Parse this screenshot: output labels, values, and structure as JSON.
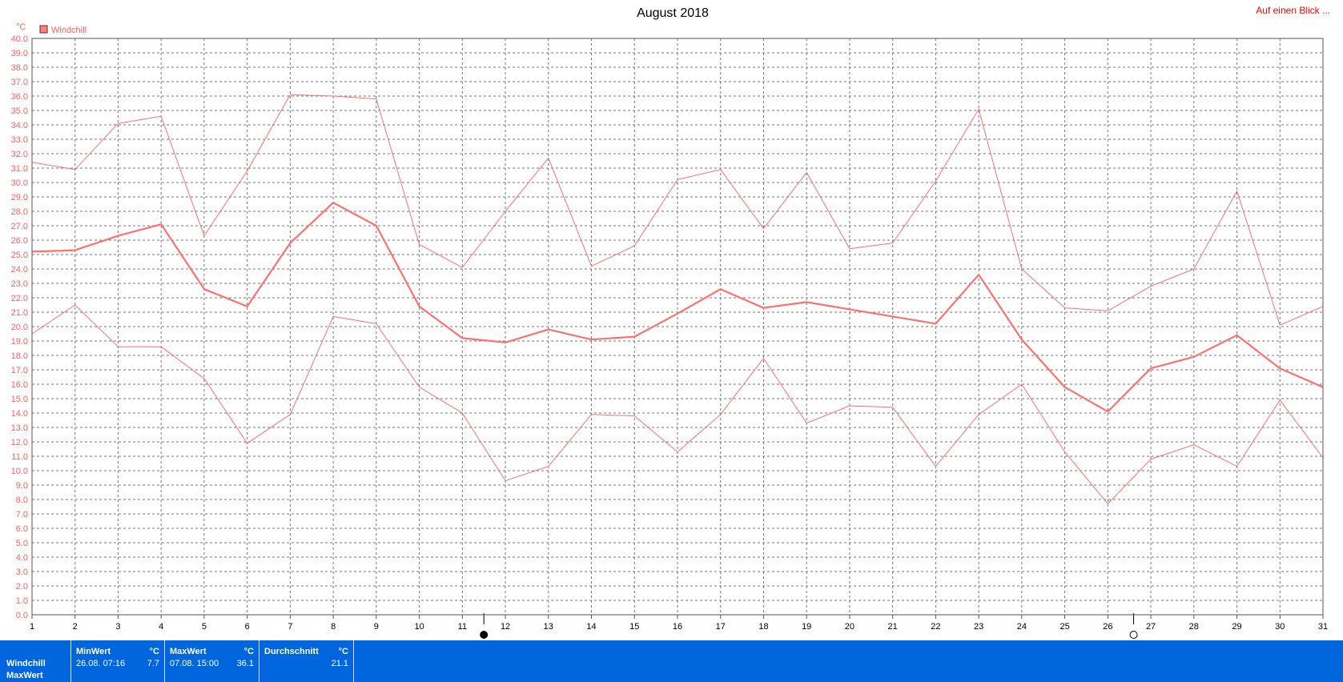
{
  "header": {
    "title": "August 2018",
    "link_label": "Auf einen Blick ..."
  },
  "colors": {
    "series": "#ff7070",
    "axis_text": "#ff6060",
    "stats_bg": "#0066dd"
  },
  "chart_data": {
    "type": "line",
    "title": "August 2018",
    "ylabel": "°C",
    "xlabel": "",
    "ylim": [
      0,
      40
    ],
    "ytick_step": 1,
    "grid": true,
    "legend": {
      "placement": "top-left",
      "entries": [
        "Windchill"
      ]
    },
    "x": [
      1,
      2,
      3,
      4,
      5,
      6,
      7,
      8,
      9,
      10,
      11,
      12,
      13,
      14,
      15,
      16,
      17,
      18,
      19,
      20,
      21,
      22,
      23,
      24,
      25,
      26,
      27,
      28,
      29,
      30,
      31
    ],
    "x_tick_labels": [
      "1",
      "2",
      "3",
      "4",
      "5",
      "6",
      "7",
      "8",
      "9",
      "10",
      "11",
      "12",
      "13",
      "14",
      "15",
      "16",
      "17",
      "18",
      "19",
      "20",
      "21",
      "22",
      "23",
      "24",
      "25",
      "26",
      "27",
      "28",
      "29",
      "30",
      "31"
    ],
    "series": [
      {
        "name": "Windchill",
        "role": "average",
        "values": [
          25.2,
          25.3,
          26.3,
          27.1,
          22.6,
          21.4,
          25.8,
          28.6,
          27.0,
          21.4,
          19.2,
          18.9,
          19.8,
          19.1,
          19.3,
          20.9,
          22.6,
          21.3,
          21.7,
          21.2,
          20.7,
          20.2,
          23.6,
          19.1,
          15.8,
          14.1,
          17.1,
          17.9,
          19.4,
          17.1,
          15.8
        ]
      },
      {
        "role": "maximum",
        "values": [
          31.4,
          30.9,
          34.1,
          34.6,
          26.3,
          30.8,
          36.1,
          36.0,
          35.8,
          25.7,
          24.1,
          28.0,
          31.7,
          24.2,
          25.6,
          30.2,
          30.9,
          26.8,
          30.7,
          25.4,
          25.8,
          30.1,
          35.1,
          24.0,
          21.3,
          21.1,
          22.8,
          24.0,
          29.4,
          20.1,
          21.4
        ]
      },
      {
        "role": "minimum",
        "values": [
          19.5,
          21.5,
          18.6,
          18.6,
          16.4,
          11.9,
          13.9,
          20.7,
          20.2,
          15.8,
          14.0,
          9.3,
          10.3,
          13.9,
          13.8,
          11.3,
          13.9,
          17.8,
          13.3,
          14.5,
          14.4,
          10.3,
          13.9,
          16.0,
          11.3,
          7.7,
          10.8,
          11.8,
          10.3,
          14.9,
          10.9
        ]
      }
    ],
    "markers": [
      {
        "name": "full-moon",
        "x": 11.5
      },
      {
        "name": "new-moon",
        "x": 26.6
      }
    ]
  },
  "stats": {
    "rows": [
      "Windchill",
      "MaxWert"
    ],
    "min": {
      "header": "MinWert",
      "unit": "°C",
      "when": "26.08.  07:16",
      "value": "7.7"
    },
    "max": {
      "header": "MaxWert",
      "unit": "°C",
      "when": "07.08.  15:00",
      "value": "36.1"
    },
    "avg": {
      "header": "Durchschnitt",
      "unit": "°C",
      "value": "21.1"
    }
  }
}
